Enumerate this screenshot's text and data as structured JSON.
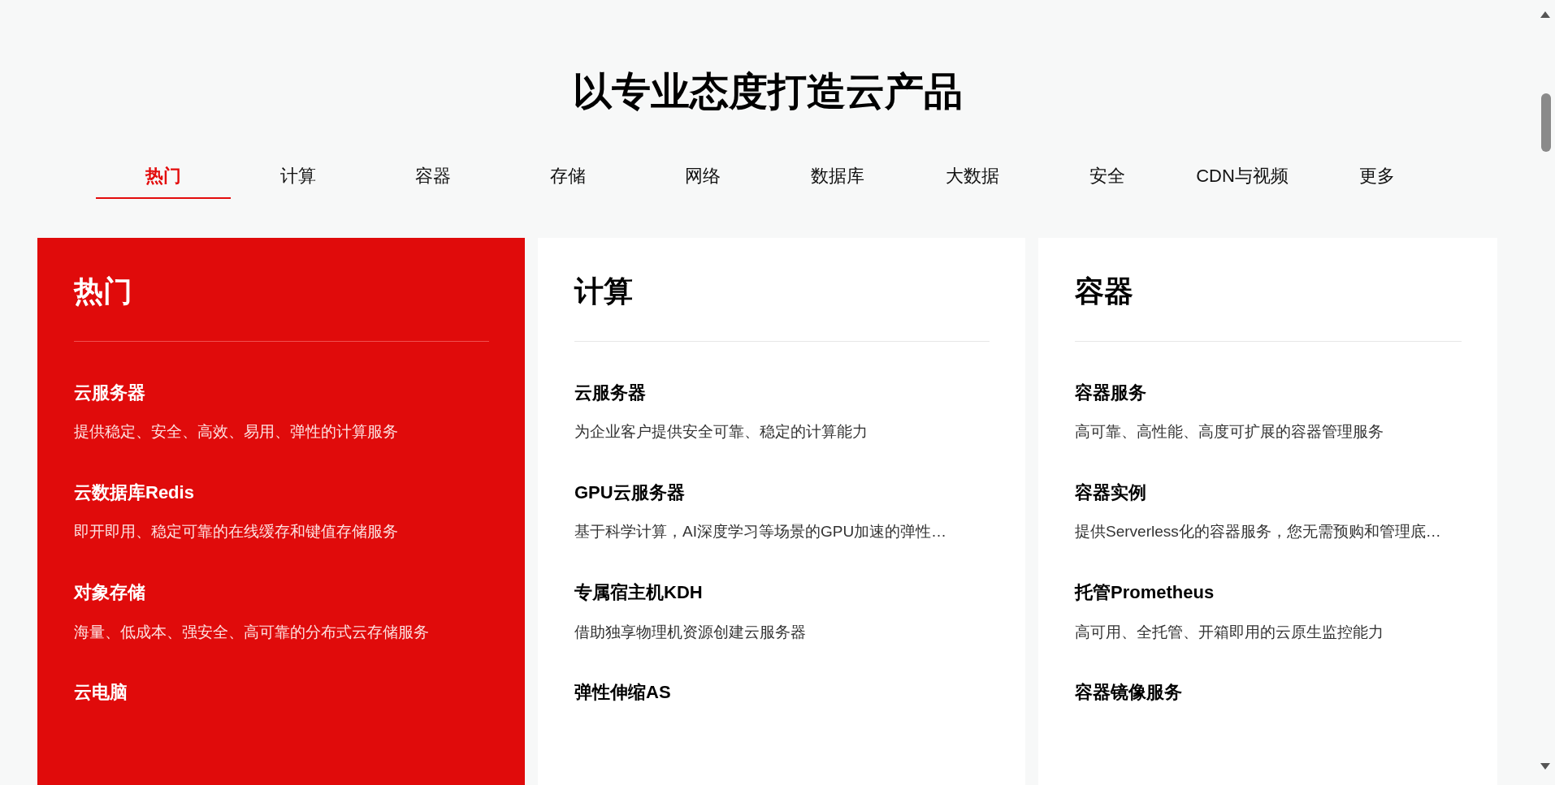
{
  "heading": "以专业态度打造云产品",
  "tabs": [
    {
      "label": "热门",
      "selected": true
    },
    {
      "label": "计算",
      "selected": false
    },
    {
      "label": "容器",
      "selected": false
    },
    {
      "label": "存储",
      "selected": false
    },
    {
      "label": "网络",
      "selected": false
    },
    {
      "label": "数据库",
      "selected": false
    },
    {
      "label": "大数据",
      "selected": false
    },
    {
      "label": "安全",
      "selected": false
    },
    {
      "label": "CDN与视频",
      "selected": false
    },
    {
      "label": "更多",
      "selected": false
    }
  ],
  "cards": [
    {
      "title": "热门",
      "highlighted": true,
      "items": [
        {
          "name": "云服务器",
          "desc": "提供稳定、安全、高效、易用、弹性的计算服务"
        },
        {
          "name": "云数据库Redis",
          "desc": "即开即用、稳定可靠的在线缓存和键值存储服务"
        },
        {
          "name": "对象存储",
          "desc": "海量、低成本、强安全、高可靠的分布式云存储服务"
        },
        {
          "name": "云电脑"
        }
      ]
    },
    {
      "title": "计算",
      "highlighted": false,
      "items": [
        {
          "name": "云服务器",
          "desc": "为企业客户提供安全可靠、稳定的计算能力"
        },
        {
          "name": "GPU云服务器",
          "desc": "基于科学计算，AI深度学习等场景的GPU加速的弹性…"
        },
        {
          "name": "专属宿主机KDH",
          "desc": "借助独享物理机资源创建云服务器"
        },
        {
          "name": "弹性伸缩AS"
        }
      ]
    },
    {
      "title": "容器",
      "highlighted": false,
      "items": [
        {
          "name": "容器服务",
          "desc": "高可靠、高性能、高度可扩展的容器管理服务"
        },
        {
          "name": "容器实例",
          "desc": "提供Serverless化的容器服务，您无需预购和管理底…"
        },
        {
          "name": "托管Prometheus",
          "desc": "高可用、全托管、开箱即用的云原生监控能力"
        },
        {
          "name": "容器镜像服务"
        }
      ]
    }
  ]
}
